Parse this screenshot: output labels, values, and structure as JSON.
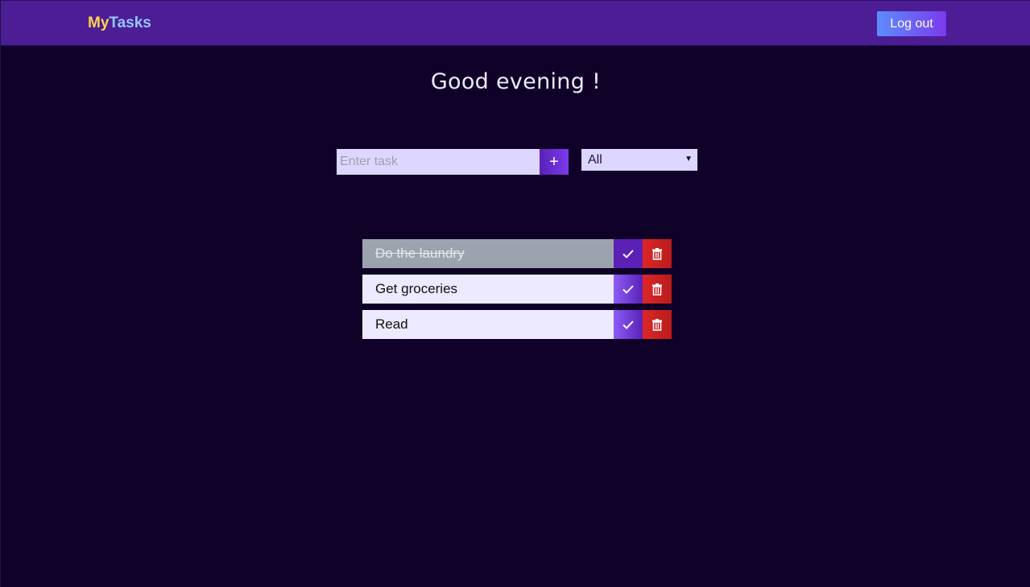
{
  "header": {
    "logo_part1": "My",
    "logo_part2": "Tasks",
    "logout_label": "Log out",
    "colors": {
      "bar": "#4c1d95",
      "logo_my": "#fcd34d",
      "logo_tasks": "#93c5fd"
    }
  },
  "greeting": "Good evening !",
  "form": {
    "task_placeholder": "Enter task",
    "task_value": "",
    "add_icon": "plus-icon",
    "filter_selected": "All"
  },
  "todos": [
    {
      "text": "Do the laundry",
      "completed": true
    },
    {
      "text": "Get groceries",
      "completed": false
    },
    {
      "text": "Read",
      "completed": false
    }
  ],
  "icons": {
    "complete": "check-icon",
    "delete": "trash-icon"
  },
  "colors": {
    "background": "#0f0127",
    "delete": "#dc2626",
    "complete": "#7c3aed"
  }
}
